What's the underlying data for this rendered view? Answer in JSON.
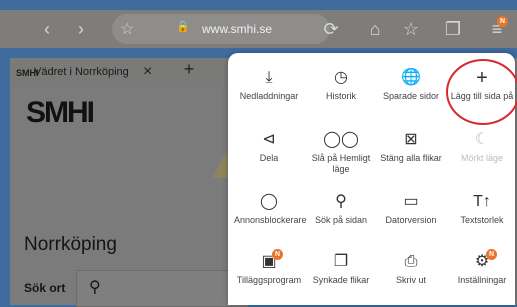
{
  "browser": {
    "url": "www.smhi.se",
    "tab_title": "Vädret i Norrköping",
    "tab_favicon_text": "SMHI",
    "badge_count": "N"
  },
  "page": {
    "logo": "SMHI",
    "city": "Norrköping",
    "search_label": "Sök ort"
  },
  "menu": {
    "items": [
      {
        "label": "Nedladdningar",
        "icon": "download-icon"
      },
      {
        "label": "Historik",
        "icon": "history-icon"
      },
      {
        "label": "Sparade sidor",
        "icon": "saved-pages-icon"
      },
      {
        "label": "Lägg till sida på",
        "icon": "plus-icon"
      },
      {
        "label": "Dela",
        "icon": "share-icon"
      },
      {
        "label": "Slå på Hemligt läge",
        "icon": "secret-mode-icon"
      },
      {
        "label": "Stäng alla flikar",
        "icon": "close-tabs-icon"
      },
      {
        "label": "Mörkt läge",
        "icon": "moon-icon"
      },
      {
        "label": "Annonsblockerare",
        "icon": "shield-icon"
      },
      {
        "label": "Sök på sidan",
        "icon": "find-icon"
      },
      {
        "label": "Datorversion",
        "icon": "desktop-icon"
      },
      {
        "label": "Textstorlek",
        "icon": "text-size-icon"
      },
      {
        "label": "Tilläggsprogram",
        "icon": "addons-icon"
      },
      {
        "label": "Synkade flikar",
        "icon": "synced-tabs-icon"
      },
      {
        "label": "Skriv ut",
        "icon": "print-icon"
      },
      {
        "label": "Inställningar",
        "icon": "settings-icon"
      }
    ]
  }
}
